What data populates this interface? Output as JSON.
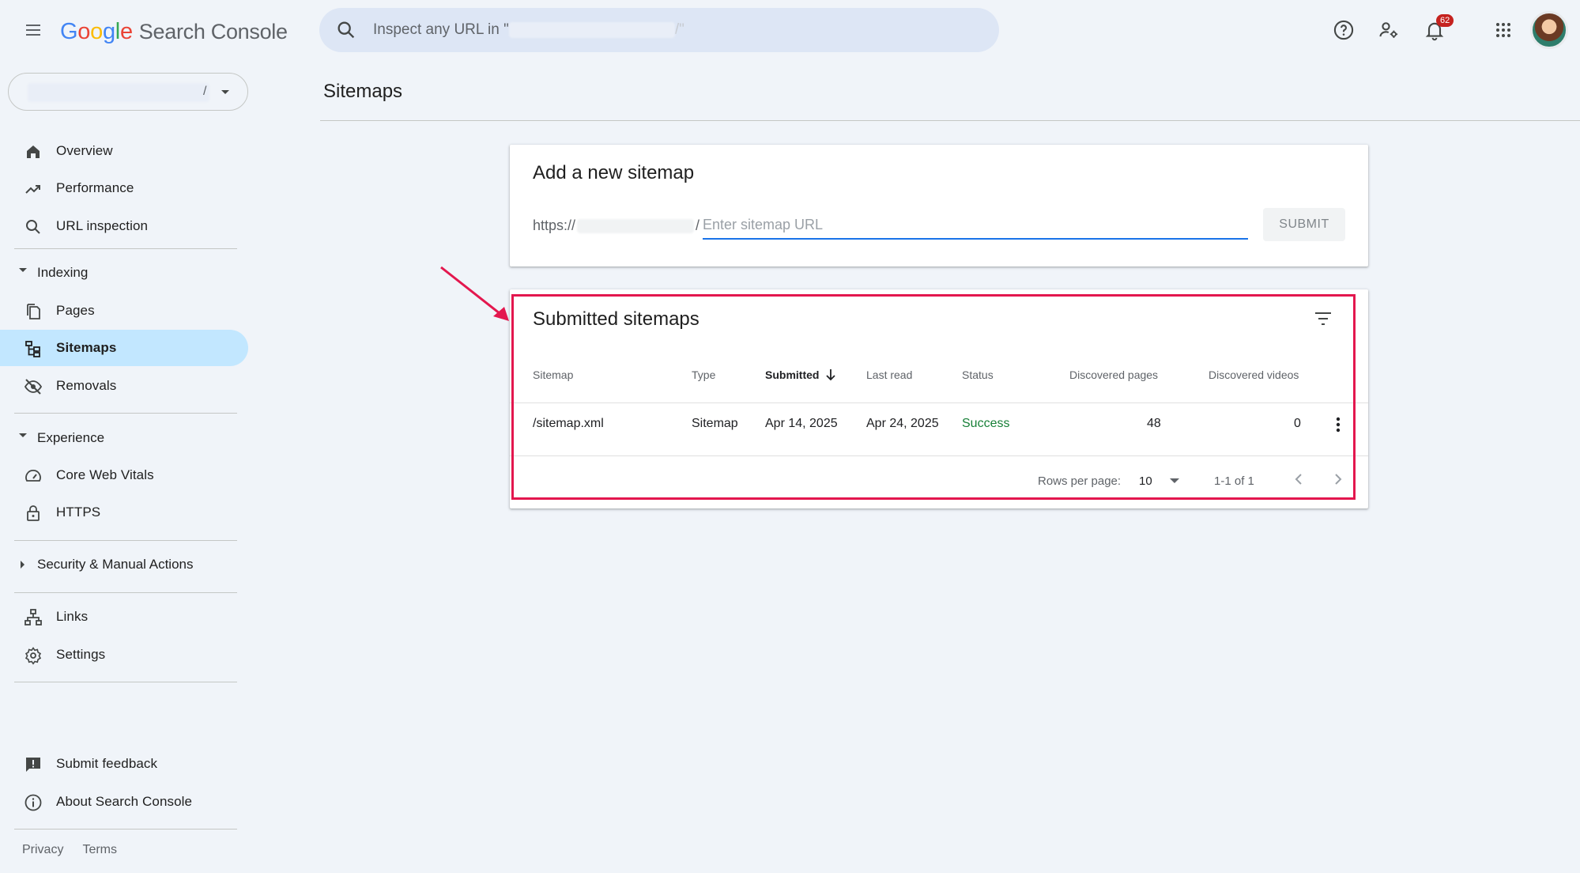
{
  "header": {
    "logo_letters": [
      "G",
      "o",
      "o",
      "g",
      "l",
      "e"
    ],
    "product_name": "Search Console",
    "search_placeholder": "Inspect any URL in \"",
    "search_placeholder_suffix": "/\"",
    "notifications_count": "62"
  },
  "property_selector": {
    "value_suffix": "/"
  },
  "sidebar": {
    "overview": "Overview",
    "performance": "Performance",
    "url_inspection": "URL inspection",
    "indexing_section": "Indexing",
    "pages": "Pages",
    "sitemaps": "Sitemaps",
    "removals": "Removals",
    "experience_section": "Experience",
    "core_web_vitals": "Core Web Vitals",
    "https": "HTTPS",
    "security_section": "Security & Manual Actions",
    "links": "Links",
    "settings": "Settings",
    "submit_feedback": "Submit feedback",
    "about": "About Search Console",
    "privacy": "Privacy",
    "terms": "Terms"
  },
  "main": {
    "page_title": "Sitemaps",
    "add_sitemap": {
      "title": "Add a new sitemap",
      "prefix_start": "https://",
      "prefix_end": "/",
      "input_placeholder": "Enter sitemap URL",
      "submit_label": "SUBMIT"
    },
    "submitted": {
      "title": "Submitted sitemaps",
      "columns": {
        "sitemap": "Sitemap",
        "type": "Type",
        "submitted": "Submitted",
        "last_read": "Last read",
        "status": "Status",
        "discovered_pages": "Discovered pages",
        "discovered_videos": "Discovered videos"
      },
      "rows": [
        {
          "sitemap": "/sitemap.xml",
          "type": "Sitemap",
          "submitted": "Apr 14, 2025",
          "last_read": "Apr 24, 2025",
          "status": "Success",
          "discovered_pages": "48",
          "discovered_videos": "0"
        }
      ],
      "pagination": {
        "rows_per_page_label": "Rows per page:",
        "rows_per_page_value": "10",
        "range": "1-1 of 1"
      }
    }
  },
  "colors": {
    "active_nav": "#c2e7ff",
    "highlight_annotation": "#e3174e",
    "success": "#188038",
    "input_focus": "#1a73e8"
  }
}
